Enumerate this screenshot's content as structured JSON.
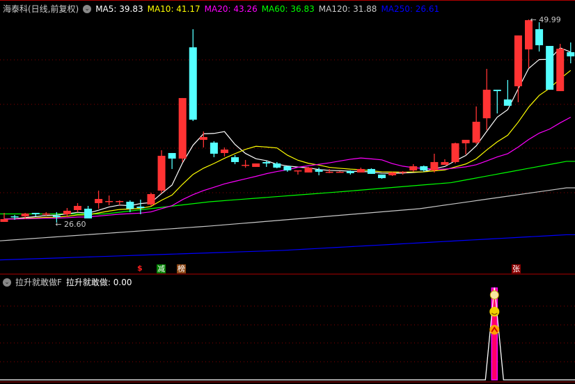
{
  "header": {
    "title": "海泰科(日线,前复权)",
    "ma": [
      {
        "label": "MA5: 39.83",
        "color": "#ffffff"
      },
      {
        "label": "MA10: 41.17",
        "color": "#ffff00"
      },
      {
        "label": "MA20: 43.26",
        "color": "#ff00ff"
      },
      {
        "label": "MA60: 36.83",
        "color": "#00ff00"
      },
      {
        "label": "MA120: 31.88",
        "color": "#c8c8c8"
      },
      {
        "label": "MA250: 26.61",
        "color": "#0000ff"
      }
    ]
  },
  "indicator": {
    "name": "拉升就敢做F",
    "value_label": "拉升就敢做: 0.00"
  },
  "markers": {
    "dollar": "$",
    "jian": "减",
    "bang": "榜",
    "zhang": "张"
  },
  "colors": {
    "up": "#ff3333",
    "down": "#54ffff",
    "grid": "#8b0000",
    "sep": "#b00000"
  },
  "chart_data": {
    "type": "candlestick",
    "title": "海泰科(日线,前复权)",
    "high_label": "49.99",
    "low_label": "26.60",
    "high_index": 50,
    "low_index": 5,
    "ylim": [
      21.5,
      50.2
    ],
    "candles": [
      [
        26.68,
        27.72,
        26.68,
        27.0
      ],
      [
        27.32,
        27.48,
        26.92,
        27.24
      ],
      [
        27.32,
        27.72,
        27.0,
        27.64
      ],
      [
        27.72,
        27.72,
        27.32,
        27.56
      ],
      [
        27.56,
        27.8,
        27.4,
        27.64
      ],
      [
        27.4,
        27.8,
        26.6,
        27.24
      ],
      [
        27.56,
        28.28,
        27.24,
        27.96
      ],
      [
        28.04,
        28.84,
        27.8,
        28.52
      ],
      [
        28.2,
        28.52,
        27.08,
        27.08
      ],
      [
        28.84,
        30.28,
        28.2,
        29.32
      ],
      [
        29.0,
        29.72,
        28.6,
        29.08
      ],
      [
        29.0,
        29.16,
        28.6,
        29.08
      ],
      [
        29.0,
        29.16,
        27.8,
        28.2
      ],
      [
        28.44,
        29.24,
        27.56,
        28.28
      ],
      [
        28.68,
        30.04,
        28.52,
        29.88
      ],
      [
        30.28,
        34.93,
        29.96,
        34.29
      ],
      [
        34.61,
        34.61,
        32.77,
        33.97
      ],
      [
        33.97,
        40.94,
        33.57,
        40.94
      ],
      [
        46.78,
        48.87,
        38.29,
        38.45
      ],
      [
        36.13,
        37.09,
        35.25,
        36.45
      ],
      [
        35.81,
        35.97,
        34.13,
        34.53
      ],
      [
        34.61,
        35.25,
        34.21,
        35.01
      ],
      [
        34.13,
        34.37,
        33.33,
        33.57
      ],
      [
        33.25,
        33.81,
        32.93,
        33.25
      ],
      [
        33.01,
        33.41,
        33.01,
        33.41
      ],
      [
        33.57,
        33.73,
        33.01,
        33.41
      ],
      [
        33.41,
        33.57,
        32.85,
        32.93
      ],
      [
        33.09,
        33.09,
        32.45,
        32.61
      ],
      [
        32.61,
        32.61,
        32.13,
        32.61
      ],
      [
        32.37,
        33.01,
        32.37,
        32.93
      ],
      [
        32.69,
        32.93,
        32.05,
        32.45
      ],
      [
        32.37,
        32.77,
        32.29,
        32.45
      ],
      [
        32.37,
        32.53,
        32.37,
        32.45
      ],
      [
        32.53,
        32.61,
        32.13,
        32.29
      ],
      [
        32.37,
        32.93,
        32.37,
        32.77
      ],
      [
        32.77,
        32.85,
        32.21,
        32.21
      ],
      [
        32.13,
        32.13,
        31.64,
        31.72
      ],
      [
        32.05,
        32.45,
        31.97,
        32.37
      ],
      [
        32.37,
        32.53,
        32.13,
        32.45
      ],
      [
        32.61,
        33.33,
        32.45,
        33.09
      ],
      [
        33.09,
        33.17,
        32.45,
        32.61
      ],
      [
        32.61,
        34.53,
        32.37,
        33.57
      ],
      [
        33.25,
        33.89,
        33.25,
        33.57
      ],
      [
        33.57,
        35.81,
        33.41,
        35.73
      ],
      [
        35.73,
        36.13,
        34.45,
        36.13
      ],
      [
        35.81,
        39.97,
        35.65,
        38.21
      ],
      [
        38.61,
        44.3,
        37.25,
        41.9
      ],
      [
        41.9,
        41.9,
        39.17,
        41.74
      ],
      [
        40.78,
        43.02,
        40.05,
        40.05
      ],
      [
        42.3,
        48.15,
        40.46,
        48.15
      ],
      [
        46.54,
        49.99,
        44.38,
        49.91
      ],
      [
        48.87,
        49.67,
        46.3,
        47.02
      ],
      [
        46.94,
        46.94,
        41.9,
        41.9
      ],
      [
        41.74,
        47.18,
        41.74,
        46.62
      ],
      [
        46.22,
        47.34,
        44.94,
        45.74
      ]
    ],
    "long_ma": [
      {
        "name": "MA60",
        "color": "#00ff00",
        "points": [
          [
            0,
            27.6
          ],
          [
            10,
            27.6
          ],
          [
            20,
            29.0
          ],
          [
            33,
            30.2
          ],
          [
            43,
            31.2
          ],
          [
            54,
            33.65
          ]
        ]
      },
      {
        "name": "MA120",
        "color": "#c8c8c8",
        "points": [
          [
            0,
            24.5
          ],
          [
            20,
            26.2
          ],
          [
            40,
            28.2
          ],
          [
            54,
            30.6
          ]
        ]
      },
      {
        "name": "MA250",
        "color": "#0000ff",
        "points": [
          [
            0,
            22.3
          ],
          [
            27,
            23.4
          ],
          [
            54,
            25.2
          ]
        ]
      }
    ],
    "indicator_values": {
      "baseline": 0,
      "peak_index": 47,
      "peak": 1
    }
  }
}
